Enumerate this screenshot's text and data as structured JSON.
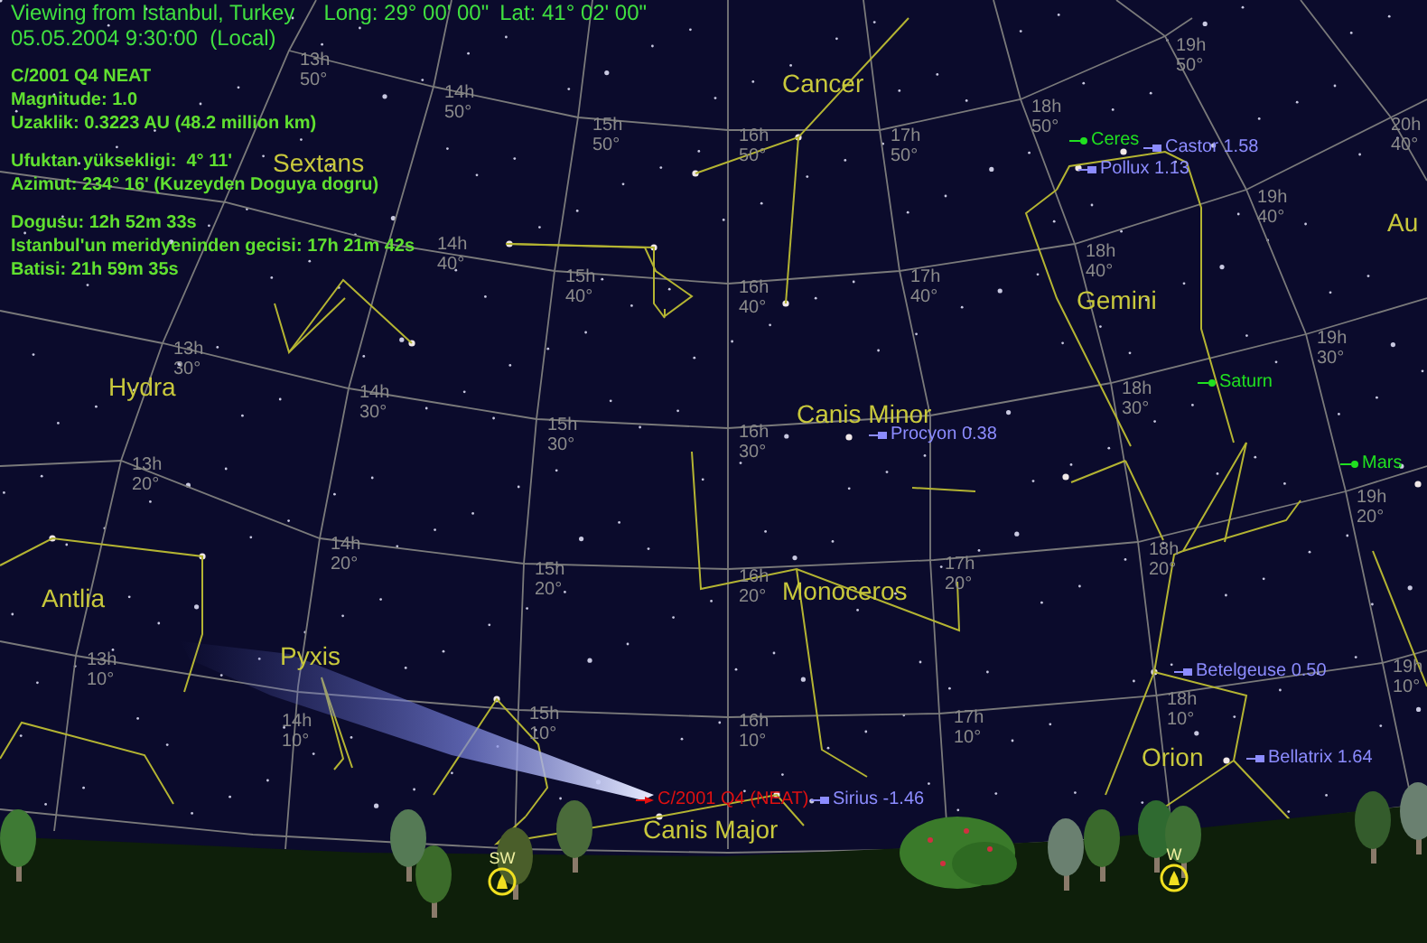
{
  "header": {
    "location": "Viewing from Istanbul, Turkey",
    "longitude": "Long: 29° 00' 00\"",
    "latitude": "Lat: 41° 02' 00\"",
    "datetime": "05.05.2004 9:30:00  (Local)"
  },
  "object_info": [
    [
      "C/2001 Q4 NEAT",
      "Magnitude: 1.0",
      "Uzaklik: 0.3223 AU (48.2 million km)"
    ],
    [
      "Ufuktan yüksekligi:  4° 11'",
      "Azimut: 234° 16' (Kuzeyden Doguya dogru)"
    ],
    [
      "Dogusu: 12h 52m 33s",
      "Istanbul'un meridyeninden gecisi: 17h 21m 42s",
      "Batisi: 21h 59m 35s"
    ]
  ],
  "constellations": [
    "Cancer",
    "Sextans",
    "Hydra",
    "Antlia",
    "Pyxis",
    "Canis Minor",
    "Monoceros",
    "Gemini",
    "Orion",
    "Canis Major",
    "Au"
  ],
  "objects": [
    {
      "kind": "planet",
      "label": "Ceres",
      "color": "#20e020"
    },
    {
      "kind": "star",
      "label": "Castor 1.58",
      "color": "#8c8cff"
    },
    {
      "kind": "star",
      "label": "Pollux 1.13",
      "color": "#8c8cff"
    },
    {
      "kind": "planet",
      "label": "Saturn",
      "color": "#20e020"
    },
    {
      "kind": "planet",
      "label": "Mars",
      "color": "#20e020"
    },
    {
      "kind": "star",
      "label": "Procyon 0.38",
      "color": "#8c8cff"
    },
    {
      "kind": "star",
      "label": "Betelgeuse 0.50",
      "color": "#8c8cff"
    },
    {
      "kind": "star",
      "label": "Bellatrix 1.64",
      "color": "#8c8cff"
    },
    {
      "kind": "star",
      "label": "Sirius -1.46",
      "color": "#8c8cff"
    },
    {
      "kind": "comet",
      "label": "C/2001 Q4 (NEAT)",
      "color": "#e01010"
    }
  ],
  "grid_labels": [
    {
      "ra": "13h",
      "dec": "50°"
    },
    {
      "ra": "14h",
      "dec": "50°"
    },
    {
      "ra": "15h",
      "dec": "50°"
    },
    {
      "ra": "16h",
      "dec": "50°"
    },
    {
      "ra": "17h",
      "dec": "50°"
    },
    {
      "ra": "18h",
      "dec": "50°"
    },
    {
      "ra": "19h",
      "dec": "50°"
    },
    {
      "ra": "14h",
      "dec": "40°"
    },
    {
      "ra": "15h",
      "dec": "40°"
    },
    {
      "ra": "16h",
      "dec": "40°"
    },
    {
      "ra": "17h",
      "dec": "40°"
    },
    {
      "ra": "18h",
      "dec": "40°"
    },
    {
      "ra": "19h",
      "dec": "40°"
    },
    {
      "ra": "20h",
      "dec": "40°"
    },
    {
      "ra": "13h",
      "dec": "30°"
    },
    {
      "ra": "14h",
      "dec": "30°"
    },
    {
      "ra": "15h",
      "dec": "30°"
    },
    {
      "ra": "16h",
      "dec": "30°"
    },
    {
      "ra": "18h",
      "dec": "30°"
    },
    {
      "ra": "19h",
      "dec": "30°"
    },
    {
      "ra": "13h",
      "dec": "20°"
    },
    {
      "ra": "14h",
      "dec": "20°"
    },
    {
      "ra": "15h",
      "dec": "20°"
    },
    {
      "ra": "16h",
      "dec": "20°"
    },
    {
      "ra": "17h",
      "dec": "20°"
    },
    {
      "ra": "18h",
      "dec": "20°"
    },
    {
      "ra": "19h",
      "dec": "20°"
    },
    {
      "ra": "13h",
      "dec": "10°"
    },
    {
      "ra": "14h",
      "dec": "10°"
    },
    {
      "ra": "15h",
      "dec": "10°"
    },
    {
      "ra": "16h",
      "dec": "10°"
    },
    {
      "ra": "17h",
      "dec": "10°"
    },
    {
      "ra": "18h",
      "dec": "10°"
    },
    {
      "ra": "19h",
      "dec": "10°"
    }
  ],
  "compass": [
    "SW",
    "W"
  ]
}
